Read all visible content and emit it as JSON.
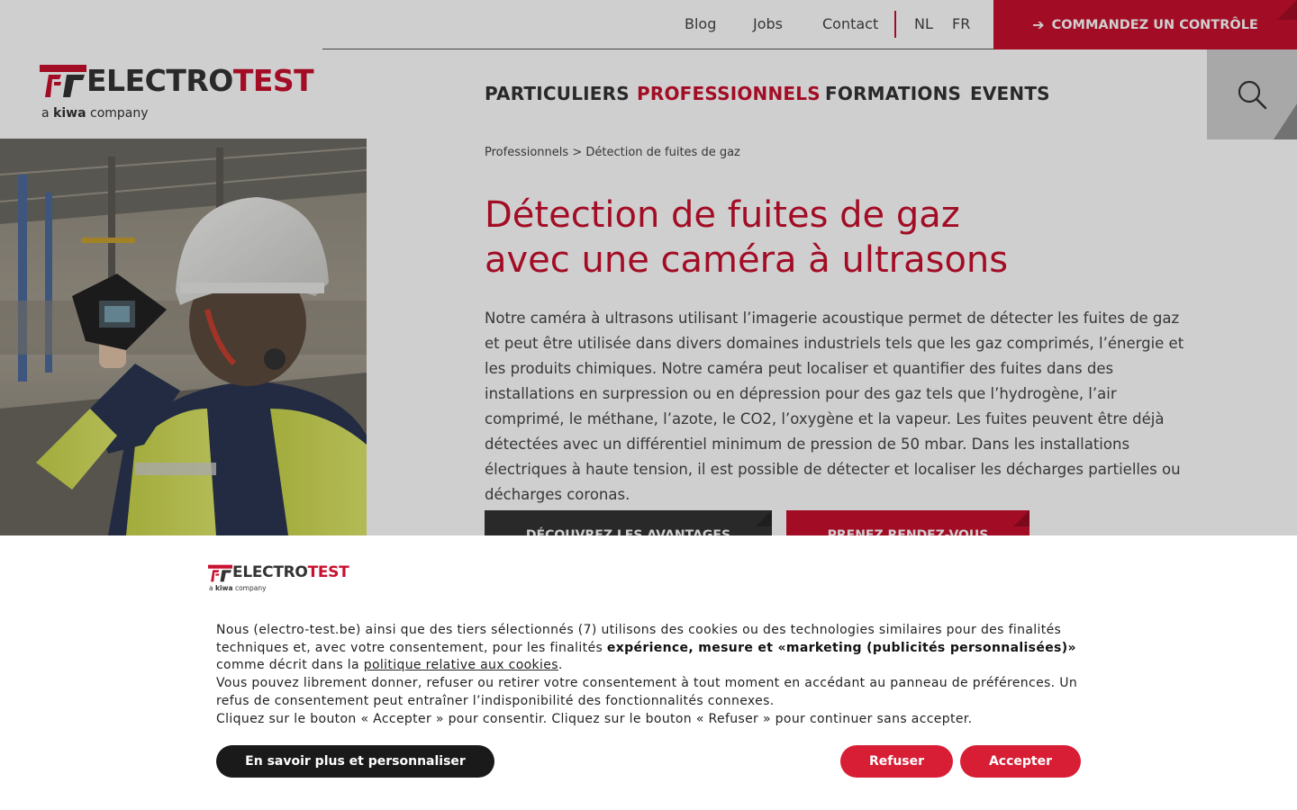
{
  "topbar": {
    "links": [
      "Blog",
      "Jobs",
      "Contact"
    ],
    "languages": [
      "NL",
      "FR"
    ],
    "order_button": "COMMANDEZ UN CONTRÔLE"
  },
  "logo": {
    "brand_part1": "ELECTRO",
    "brand_part2": "TEST",
    "tagline_prefix": "a",
    "tagline_brand": "kiwa",
    "tagline_suffix": "company"
  },
  "nav": {
    "items": [
      "PARTICULIERS",
      "PROFESSIONNELS",
      "FORMATIONS",
      "EVENTS"
    ],
    "active": "PROFESSIONNELS"
  },
  "breadcrumb": {
    "parent": "Professionnels",
    "separator": ">",
    "current": "Détection de fuites de gaz"
  },
  "main": {
    "title_line1": "Détection de fuites de gaz",
    "title_line2": "avec une caméra à ultrasons",
    "intro": "Notre caméra à ultrasons utilisant l’imagerie acoustique permet de détecter les fuites de gaz et peut être utilisée dans divers domaines industriels tels que les gaz comprimés, l’énergie et les produits chimiques. Notre caméra peut localiser et quantifier des fuites dans des installations en surpression ou en dépression pour des gaz tels que l’hydrogène, l’air comprimé, le méthane, l’azote, le CO2, l’oxygène et la vapeur. Les fuites peuvent être déjà détectées avec un différentiel minimum de pression de 50 mbar. Dans les installations électriques à haute tension, il est possible de détecter et localiser les décharges partielles ou décharges coronas.",
    "btn_advantages": "DÉCOUVREZ LES AVANTAGES",
    "btn_appointment": "PRENEZ RENDEZ-VOUS"
  },
  "cookie": {
    "p1_a": "Nous (electro-test.be) ainsi que des tiers sélectionnés (7) utilisons des cookies ou des technologies similaires pour des finalités techniques et, avec votre consentement, pour les finalités ",
    "p1_bold": "expérience, mesure et «marketing (publicités personnalisées)»",
    "p1_b": " comme décrit dans la ",
    "p1_link": "politique relative aux cookies",
    "p1_end": ".",
    "p2": "Vous pouvez librement donner, refuser ou retirer votre consentement à tout moment en accédant au panneau de préférences. Un refus de consentement peut entraîner l’indisponibilité des fonctionnalités connexes.",
    "p3": "Cliquez sur le bouton « Accepter » pour consentir. Cliquez sur le bouton « Refuser » pour continuer sans accepter.",
    "btn_more": "En savoir plus et personnaliser",
    "btn_refuse": "Refuser",
    "btn_accept": "Accepter"
  },
  "colors": {
    "brand_red": "#c8102e",
    "dark": "#333333",
    "button_red": "#d81e34"
  }
}
